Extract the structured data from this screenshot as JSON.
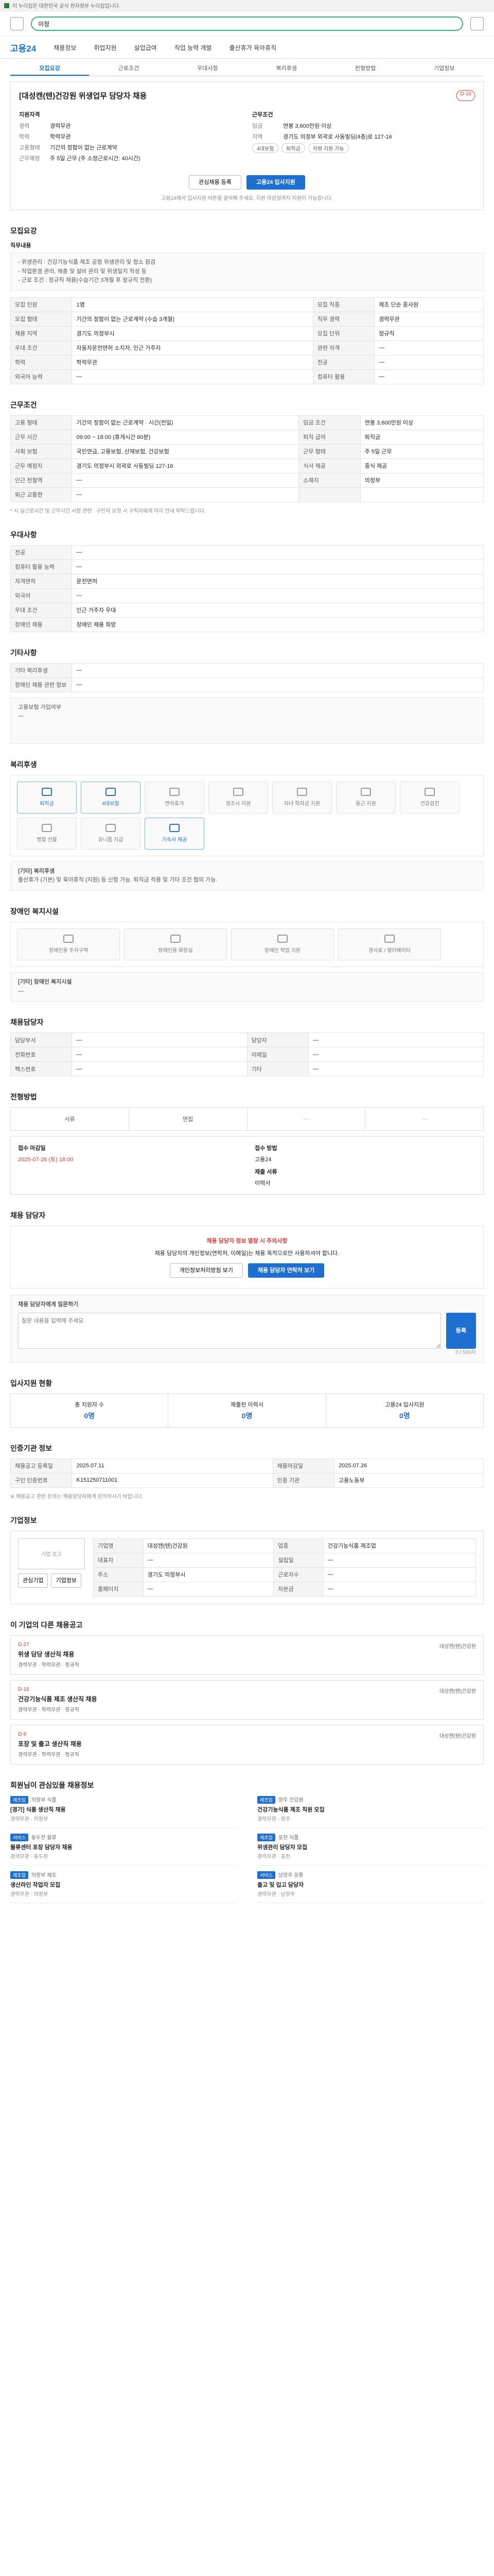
{
  "topbar": {
    "label": "이 누리집은 대한민국 공식 전자정부 누리집입니다."
  },
  "search": {
    "value": "이정"
  },
  "nav": {
    "logo": "고용24",
    "items": [
      "채용정보",
      "취업지원",
      "실업급여",
      "직업 능력 개발",
      "출산휴가 육아휴직"
    ]
  },
  "tabs": [
    "모집요강",
    "근로조건",
    "우대사항",
    "복리후생",
    "전형방법",
    "기업정보"
  ],
  "job": {
    "title": "[대성캔(텐)건강원 위생업무 담당자 채용",
    "badge": "D-16",
    "left_h": "지원자격",
    "right_h": "근무조건",
    "left": [
      {
        "k": "경력",
        "v": "경력무관"
      },
      {
        "k": "학력",
        "v": "학력무관"
      },
      {
        "k": "고용형태",
        "v": "기간의 정함이 없는 근로계약"
      },
      {
        "k": "근무예정",
        "v": "주 5일 근무 (주 소정근로시간: 40시간)"
      }
    ],
    "right": [
      {
        "k": "임금",
        "v": "연봉 3,600만원 이상"
      },
      {
        "k": "지역",
        "v": "경기도 의정부 외곽로 사동빌딩(4층)로 127-16"
      }
    ],
    "pills": [
      "4대보험",
      "퇴직금",
      "차량 지원 가능"
    ],
    "btn_scrap": "관심채용 등록",
    "btn_apply": "고용24 입사지원",
    "note": "고용24에서 입사지원 버튼을 클릭해 주세요. 지원 마감일까지 지원이 가능합니다."
  },
  "recruit": {
    "title": "모집요강",
    "duty_h": "직무내용",
    "duty": "- 위생관리 : 건강기능식품 제조 공정 위생관리 및 청소 점검\n- 작업환경 관리, 해충 및 설비 관리 및 위생일지 작성 등\n- 근로 조건 : 정규직 채용(수습기간 3개월 후 정규직 전환)",
    "rows": [
      [
        "모집 인원",
        "1명",
        "모집 직종",
        "제조 단순 종사원"
      ],
      [
        "모집 형태",
        "기간의 정함이 없는 근로계약 (수습 3개월)",
        "직무 경력",
        "경력무관"
      ],
      [
        "채용 지역",
        "경기도 의정부시",
        "모집 단위",
        "정규직"
      ],
      [
        "우대 조건",
        "자동차운전면허 소지자, 인근 거주자",
        "관련 자격",
        "—"
      ],
      [
        "학력",
        "학력무관",
        "전공",
        "—"
      ],
      [
        "외국어 능력",
        "—",
        "컴퓨터 활용",
        "—"
      ]
    ]
  },
  "conditions": {
    "title": "근무조건",
    "rows": [
      [
        "고용 형태",
        "기간의 정함이 없는 근로계약 · 시간(전일)",
        "임금 조건",
        "연봉 3,600만원 이상"
      ],
      [
        "근무 시간",
        "09:00 ~ 18:00 (휴게시간 60분)",
        "퇴직 급여",
        "퇴직금"
      ],
      [
        "사회 보험",
        "국민연금, 고용보험, 산재보험, 건강보험",
        "근무 형태",
        "주 5일 근무"
      ],
      [
        "근무 예정지",
        "경기도 의정부시 외곽로 사동빌딩 127-16",
        "식사 제공",
        "중식 제공"
      ],
      [
        "인근 전철역",
        "—",
        "소재지",
        "의정부"
      ],
      [
        "퇴근 교통편",
        "—",
        "",
        ""
      ]
    ],
    "note": "* 시 실근로시간 및 근무시간 사항 관련 : 구인자 요청 시 구직자에게 미리 안내 부탁드립니다."
  },
  "prefer": {
    "title": "우대사항",
    "rows": [
      [
        "전공",
        "—"
      ],
      [
        "컴퓨터 활용 능력",
        "—"
      ],
      [
        "자격면허",
        "운전면허"
      ],
      [
        "외국어",
        "—"
      ],
      [
        "우대 조건",
        "인근 거주자 우대"
      ],
      [
        "장애인 채용",
        "장애인 채용 희망"
      ]
    ]
  },
  "others": {
    "title": "기타사항",
    "rows": [
      [
        "기타 복리후생",
        "—"
      ],
      [
        "장애인 채용 관련 정보",
        "—"
      ]
    ],
    "box_h": "고용보험 가입여부",
    "box": "—"
  },
  "welfare": {
    "title": "복리후생",
    "items": [
      {
        "label": "퇴직금",
        "on": true
      },
      {
        "label": "4대보험",
        "on": true
      },
      {
        "label": "연차휴가",
        "on": false
      },
      {
        "label": "경조사 지원",
        "on": false
      },
      {
        "label": "자녀 학자금 지원",
        "on": false
      },
      {
        "label": "통근 지원",
        "on": false
      },
      {
        "label": "건강검진",
        "on": false
      },
      {
        "label": "명절 선물",
        "on": false
      },
      {
        "label": "유니폼 지급",
        "on": false
      },
      {
        "label": "기숙사 제공",
        "on": true
      }
    ],
    "etc_h": "[기타] 복리후생",
    "etc": "출산휴가 (기본) 및 육아휴직 (지원) 등 신청 가능. 퇴직금 적용 및 기타 조건 협의 가능."
  },
  "disabled": {
    "title": "장애인 복지시설",
    "items": [
      "장애인용 주차구역",
      "장애인용 화장실",
      "장애인 작업 지원",
      "경사로 / 엘리베이터"
    ],
    "etc_h": "[기타] 장애인 복지시설",
    "etc": "—"
  },
  "employer": {
    "title": "채용담당자",
    "rows": [
      [
        "담당부서",
        "—",
        "담당자",
        "—"
      ],
      [
        "전화번호",
        "—",
        "이메일",
        "—"
      ],
      [
        "팩스번호",
        "—",
        "기타",
        "—"
      ]
    ]
  },
  "process": {
    "title": "전형방법",
    "steps": [
      "서류",
      "면접",
      "—",
      "—"
    ],
    "apply_h": "접수 마감일",
    "deadline": "2025-07-26 (토) 18:00",
    "method_h": "접수 방법",
    "method": "고용24",
    "doc_h": "제출 서류",
    "doc": "이력서"
  },
  "contact": {
    "title": "채용 담당자",
    "warn_t": "채용 담당자 정보 열람 시 주의사항",
    "warn": "채용 담당자의 개인정보(연락처, 이메일)는 채용 목적으로만 사용하셔야 합니다.",
    "btn1": "개인정보처리방침 보기",
    "btn2": "채용 담당자 연락처 보기"
  },
  "inquiry": {
    "title": "채용 담당자에게 질문하기",
    "placeholder": "질문 내용을 입력해 주세요.",
    "count": "0 / 500자",
    "btn": "등록"
  },
  "stats": {
    "title": "입사지원 현황",
    "items": [
      {
        "k": "총 지원자 수",
        "v": "0명"
      },
      {
        "k": "제출된 이력서",
        "v": "0명"
      },
      {
        "k": "고용24 입사지원",
        "v": "0명"
      }
    ]
  },
  "info": {
    "title": "인증기관 정보",
    "rows": [
      [
        "채용공고 등록일",
        "2025.07.11"
      ],
      [
        "채용마감일",
        "2025.07.26"
      ],
      [
        "구인 인증번호",
        "K151250711001"
      ],
      [
        "인증 기관",
        "고용노동부"
      ]
    ],
    "note": "※ 채용공고 관련 문의는 채용담당자에게 문의하시기 바랍니다."
  },
  "company": {
    "title": "기업정보",
    "logo": "기업 로고",
    "btn1": "관심기업",
    "btn2": "기업정보",
    "rows": [
      [
        "기업명",
        "대성캔(텐)건강원",
        "업종",
        "건강기능식품 제조업"
      ],
      [
        "대표자",
        "—",
        "설립일",
        "—"
      ],
      [
        "주소",
        "경기도 의정부시",
        "근로자수",
        "—"
      ],
      [
        "홈페이지",
        "—",
        "자본금",
        "—"
      ]
    ]
  },
  "others_jobs": {
    "title": "이 기업의 다른 채용공고",
    "items": [
      {
        "date": "D-27",
        "name": "위생 담당 생산직 채용",
        "tags": "경력무관 · 학력무관 · 정규직",
        "co": "대성캔(텐)건강원"
      },
      {
        "date": "D-15",
        "name": "건강기능식품 제조 생산직 채용",
        "tags": "경력무관 · 학력무관 · 정규직",
        "co": "대성캔(텐)건강원"
      },
      {
        "date": "D-9",
        "name": "포장 및 출고 생산직 채용",
        "tags": "경력무관 · 학력무관 · 정규직",
        "co": "대성캔(텐)건강원"
      }
    ]
  },
  "recommend": {
    "title": "회원님이 관심있을 채용정보",
    "items": [
      {
        "cat": "제조업",
        "co": "의정부 식품",
        "name": "[경기] 식품 생산직 채용",
        "meta": "경력무관 · 의정부"
      },
      {
        "cat": "제조업",
        "co": "양주 건강원",
        "name": "건강기능식품 제조 직원 모집",
        "meta": "경력무관 · 양주"
      },
      {
        "cat": "서비스",
        "co": "동두천 물류",
        "name": "물류센터 포장 담당자 채용",
        "meta": "경력무관 · 동두천"
      },
      {
        "cat": "제조업",
        "co": "포천 식품",
        "name": "위생관리 담당자 모집",
        "meta": "경력무관 · 포천"
      },
      {
        "cat": "제조업",
        "co": "의정부 제조",
        "name": "생산라인 작업자 모집",
        "meta": "경력무관 · 의정부"
      },
      {
        "cat": "서비스",
        "co": "남양주 유통",
        "name": "출고 및 입고 담당자",
        "meta": "경력무관 · 남양주"
      }
    ]
  }
}
